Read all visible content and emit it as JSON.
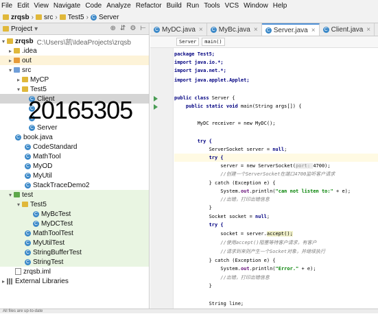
{
  "menu": [
    "File",
    "Edit",
    "View",
    "Navigate",
    "Code",
    "Analyze",
    "Refactor",
    "Build",
    "Run",
    "Tools",
    "VCS",
    "Window",
    "Help"
  ],
  "nav": {
    "project": "zrqsb",
    "folder": "src",
    "package": "Test5",
    "cls": "Server"
  },
  "project_panel": {
    "title": "Project",
    "root_name": "zrqsb",
    "root_path": "C:\\Users\\凯\\IdeaProjects\\zrqsb",
    "items": [
      ".idea",
      "out",
      "src",
      "MyCP",
      "Test5",
      "Client",
      "Server",
      "book.java",
      "CodeStandard",
      "MathTool",
      "MyOD",
      "MyUtil",
      "StackTraceDemo2",
      "test",
      "Test5",
      "MyBcTest",
      "MyDCTest",
      "MathToolTest",
      "MyUtilTest",
      "StringBufferTest",
      "StringTest",
      "zrqsb.iml",
      "External Libraries"
    ]
  },
  "overlay_text": "20165305",
  "tabs": [
    {
      "label": "MyDC.java",
      "active": false
    },
    {
      "label": "MyBc.java",
      "active": false
    },
    {
      "label": "Server.java",
      "active": true
    },
    {
      "label": "Client.java",
      "active": false
    }
  ],
  "code_crumbs": [
    "Server",
    "main()"
  ],
  "code": {
    "l1": "package Test5;",
    "l2": "import java.io.*;",
    "l3": "import java.net.*;",
    "l4": "import java.applet.Applet;",
    "l5a": "public class ",
    "l5b": "Server {",
    "l6a": "    public static void ",
    "l6b": "main(String args[]) {",
    "l7": "        MyDC receiver = new MyDC();",
    "l8": "        try {",
    "l9a": "            ServerSocket server = ",
    "l9b": "null",
    "l10": "            try {",
    "l11a": "                server = new ServerSocket(",
    "l11h": "port: ",
    "l11b": "4700);",
    "l12": "                //创建一个ServerSocket在端口4700监听客户请求",
    "l13a": "            } catch (Exception e) {",
    "l14a": "                System.",
    "l14f": "out",
    "l14b": ".println(",
    "l14s": "\"can not listen to:\"",
    "l14c": " + e);",
    "l15": "                //出错，打印出错信息",
    "l16": "            }",
    "l17a": "            Socket socket = ",
    "l17b": "null",
    "l18": "            try {",
    "l19a": "                socket = server.",
    "l19b": "accept();",
    "l20": "                //使用accept()阻塞等待客户请求，有客户",
    "l21": "                //请求到来则产生一个Socket对象，并继续执行",
    "l22": "            } catch (Exception e) {",
    "l23a": "                System.",
    "l23f": "out",
    "l23b": ".println(",
    "l23s": "\"Error.\"",
    "l23c": " + e);",
    "l24": "                //出错，打印出错信息",
    "l25": "            }",
    "l26": "            String line;"
  },
  "status": "All files are up-to-date"
}
